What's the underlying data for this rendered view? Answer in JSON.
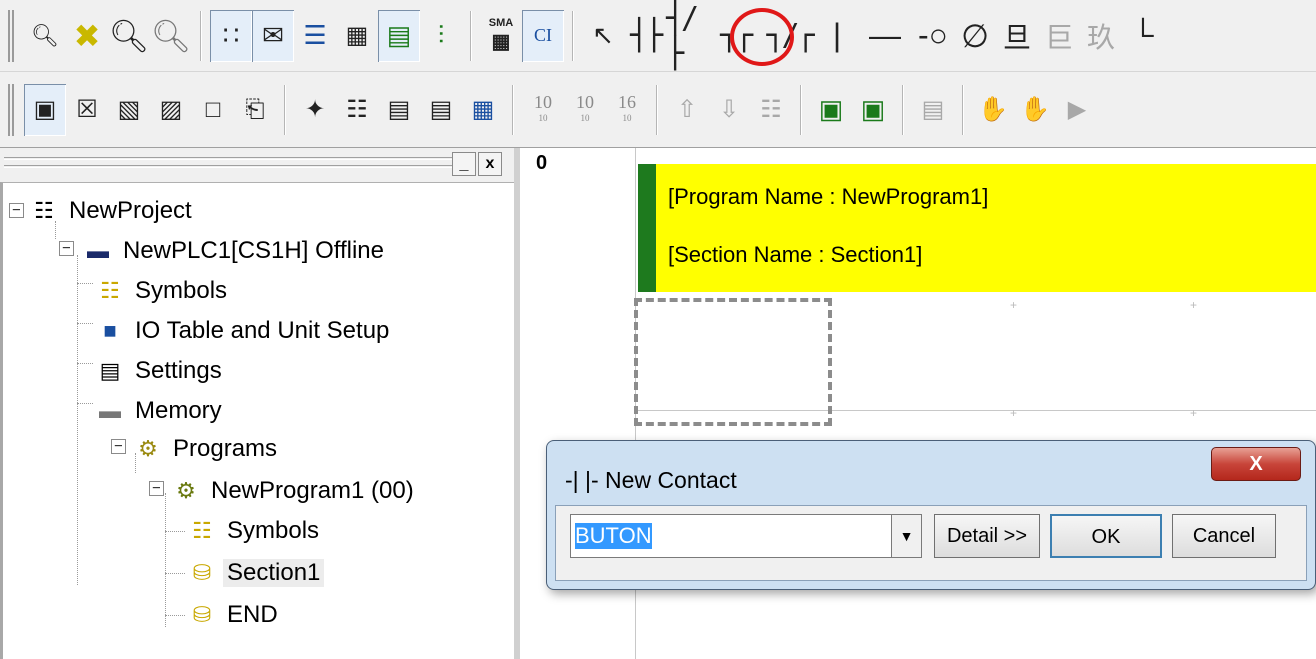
{
  "toolbar1": {
    "icons": [
      "zoom-small-icon",
      "find-icon",
      "zoom-in-icon",
      "zoom-out-icon",
      "grid-toggle-icon",
      "comment-icon",
      "list-icon",
      "io-comment-icon",
      "rung-comment-icon",
      "tree-icon",
      "sma-icon",
      "ci-icon",
      "select-mode-icon",
      "contact-no-icon",
      "contact-nc-icon",
      "contact-or-icon",
      "contact-ornc-icon",
      "vertical-line-icon",
      "horizontal-line-icon",
      "coil-icon",
      "coil-nc-icon",
      "instruction-icon",
      "instruction2-icon",
      "instruction3-icon",
      "line-corner-icon"
    ],
    "sma_label": "SMA",
    "ci_label": "CI"
  },
  "toolbar2": {
    "icons": [
      "project-view-icon",
      "graph-icon",
      "chart-icon",
      "chart2-icon",
      "window-icon",
      "props-icon",
      "cross-ref-icon",
      "symbols-icon",
      "io-table-icon",
      "memory-view-icon",
      "binary-icon",
      "decimal-icon",
      "decimal-signed-icon",
      "hex-icon",
      "transfer-up-icon",
      "transfer-down-icon",
      "compare-icon",
      "online-icon",
      "monitor-icon",
      "edit-icon",
      "hand-icon",
      "hand2-icon",
      "run-icon"
    ],
    "num_labels": [
      {
        "top": "10",
        "bottom": "10"
      },
      {
        "top": "10",
        "bottom": "10"
      },
      {
        "top": "16",
        "bottom": "10"
      }
    ]
  },
  "left_panel": {
    "close_glyph": "x",
    "minimize_glyph": "_"
  },
  "tree": [
    {
      "label": "NewProject",
      "icon": "network-icon"
    },
    {
      "label": "NewPLC1[CS1H] Offline",
      "icon": "plc-icon"
    },
    {
      "label": "Symbols",
      "icon": "symbols-icon"
    },
    {
      "label": "IO Table and Unit Setup",
      "icon": "io-table-icon"
    },
    {
      "label": "Settings",
      "icon": "settings-icon"
    },
    {
      "label": "Memory",
      "icon": "memory-icon"
    },
    {
      "label": "Programs",
      "icon": "programs-icon"
    },
    {
      "label": "NewProgram1 (00)",
      "icon": "program-icon"
    },
    {
      "label": "Symbols",
      "icon": "symbols-icon"
    },
    {
      "label": "Section1",
      "icon": "section-icon"
    },
    {
      "label": "END",
      "icon": "section-icon"
    }
  ],
  "editor": {
    "rung_number": "0",
    "program_comment": "[Program Name : NewProgram1]",
    "section_comment": "[Section Name : Section1]"
  },
  "dialog": {
    "title": "-| |- New Contact",
    "close_glyph": "X",
    "input_value": "BUTON",
    "detail_label": "Detail >>",
    "ok_label": "OK",
    "cancel_label": "Cancel"
  }
}
